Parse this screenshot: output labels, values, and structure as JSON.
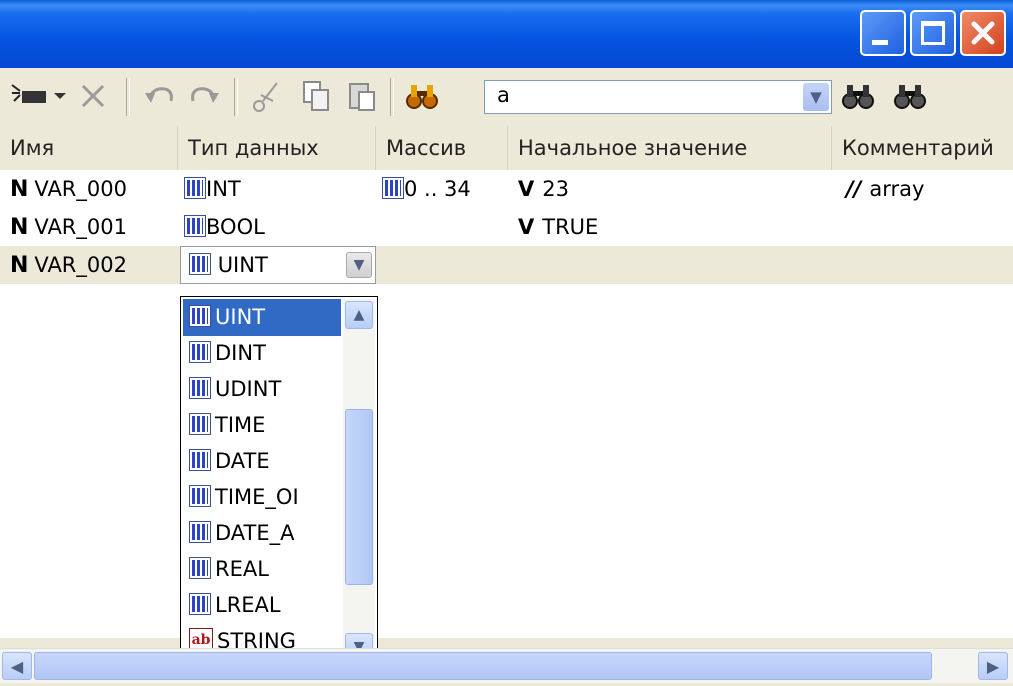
{
  "window": {
    "controls": {
      "minimize_icon": "minimize-icon",
      "maximize_icon": "maximize-icon",
      "close_icon": "close-icon"
    }
  },
  "toolbar": {
    "search": {
      "value": "a"
    },
    "buttons": [
      "new-variable-icon",
      "delete-icon",
      "undo-icon",
      "redo-icon",
      "cut-icon",
      "copy-icon",
      "paste-icon",
      "find-icon",
      "find-prev-icon",
      "find-next-icon"
    ]
  },
  "header": {
    "name": "Имя",
    "type": "Тип данных",
    "array": "Массив",
    "initial": "Начальное значение",
    "comment": "Комментарий"
  },
  "rows": [
    {
      "kind": "N",
      "name": "VAR_000",
      "type": "INT",
      "array": "0 .. 34",
      "init_kind": "V",
      "initial": "23",
      "comment_kind": "//",
      "comment": "array"
    },
    {
      "kind": "N",
      "name": "VAR_001",
      "type": "BOOL",
      "array": "",
      "init_kind": "V",
      "initial": "TRUE",
      "comment_kind": "",
      "comment": ""
    },
    {
      "kind": "N",
      "name": "VAR_002",
      "type": "UINT",
      "array": "",
      "init_kind": "",
      "initial": "",
      "comment_kind": "",
      "comment": ""
    }
  ],
  "dropdown": {
    "selected": "UINT",
    "items": [
      "UINT",
      "DINT",
      "UDINT",
      "TIME",
      "DATE",
      "TIME_OI",
      "DATE_A",
      "REAL",
      "LREAL",
      "STRING"
    ]
  },
  "colors": {
    "selection": "#316ac5",
    "titlebar": "#0553e1",
    "chrome": "#ece9d8"
  }
}
